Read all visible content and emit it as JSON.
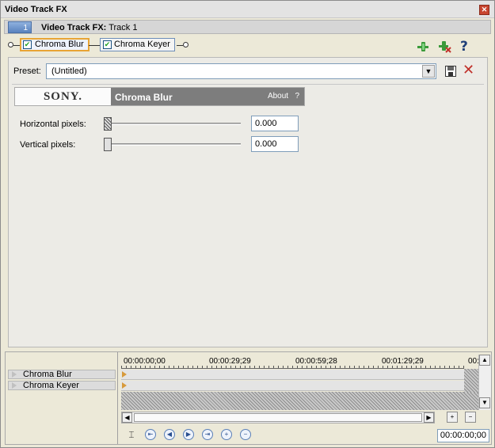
{
  "window": {
    "title": "Video Track FX"
  },
  "track": {
    "number": "1",
    "label": "Video Track FX:",
    "name": "Track 1"
  },
  "chain": {
    "plugins": [
      {
        "label": "Chroma Blur",
        "checked": true,
        "active": true
      },
      {
        "label": "Chroma Keyer",
        "checked": true,
        "active": false
      }
    ]
  },
  "preset": {
    "label": "Preset:",
    "value": "(Untitled)"
  },
  "plugin": {
    "vendor": "SONY.",
    "name": "Chroma Blur",
    "about": "About",
    "help": "?"
  },
  "params": [
    {
      "label": "Horizontal pixels:",
      "value": "0.000",
      "slider": 0
    },
    {
      "label": "Vertical pixels:",
      "value": "0.000",
      "slider": 0
    }
  ],
  "timeline": {
    "tracks": [
      "Chroma Blur",
      "Chroma Keyer"
    ],
    "ruler": [
      "00:00:00;00",
      "00:00:29;29",
      "00:00:59;28",
      "00:01:29;29",
      "00:"
    ],
    "timecode": "00:00:00;00"
  },
  "colors": {
    "accent": "#e8a435",
    "header": "#7d7d7d",
    "delete": "#c0302a"
  }
}
